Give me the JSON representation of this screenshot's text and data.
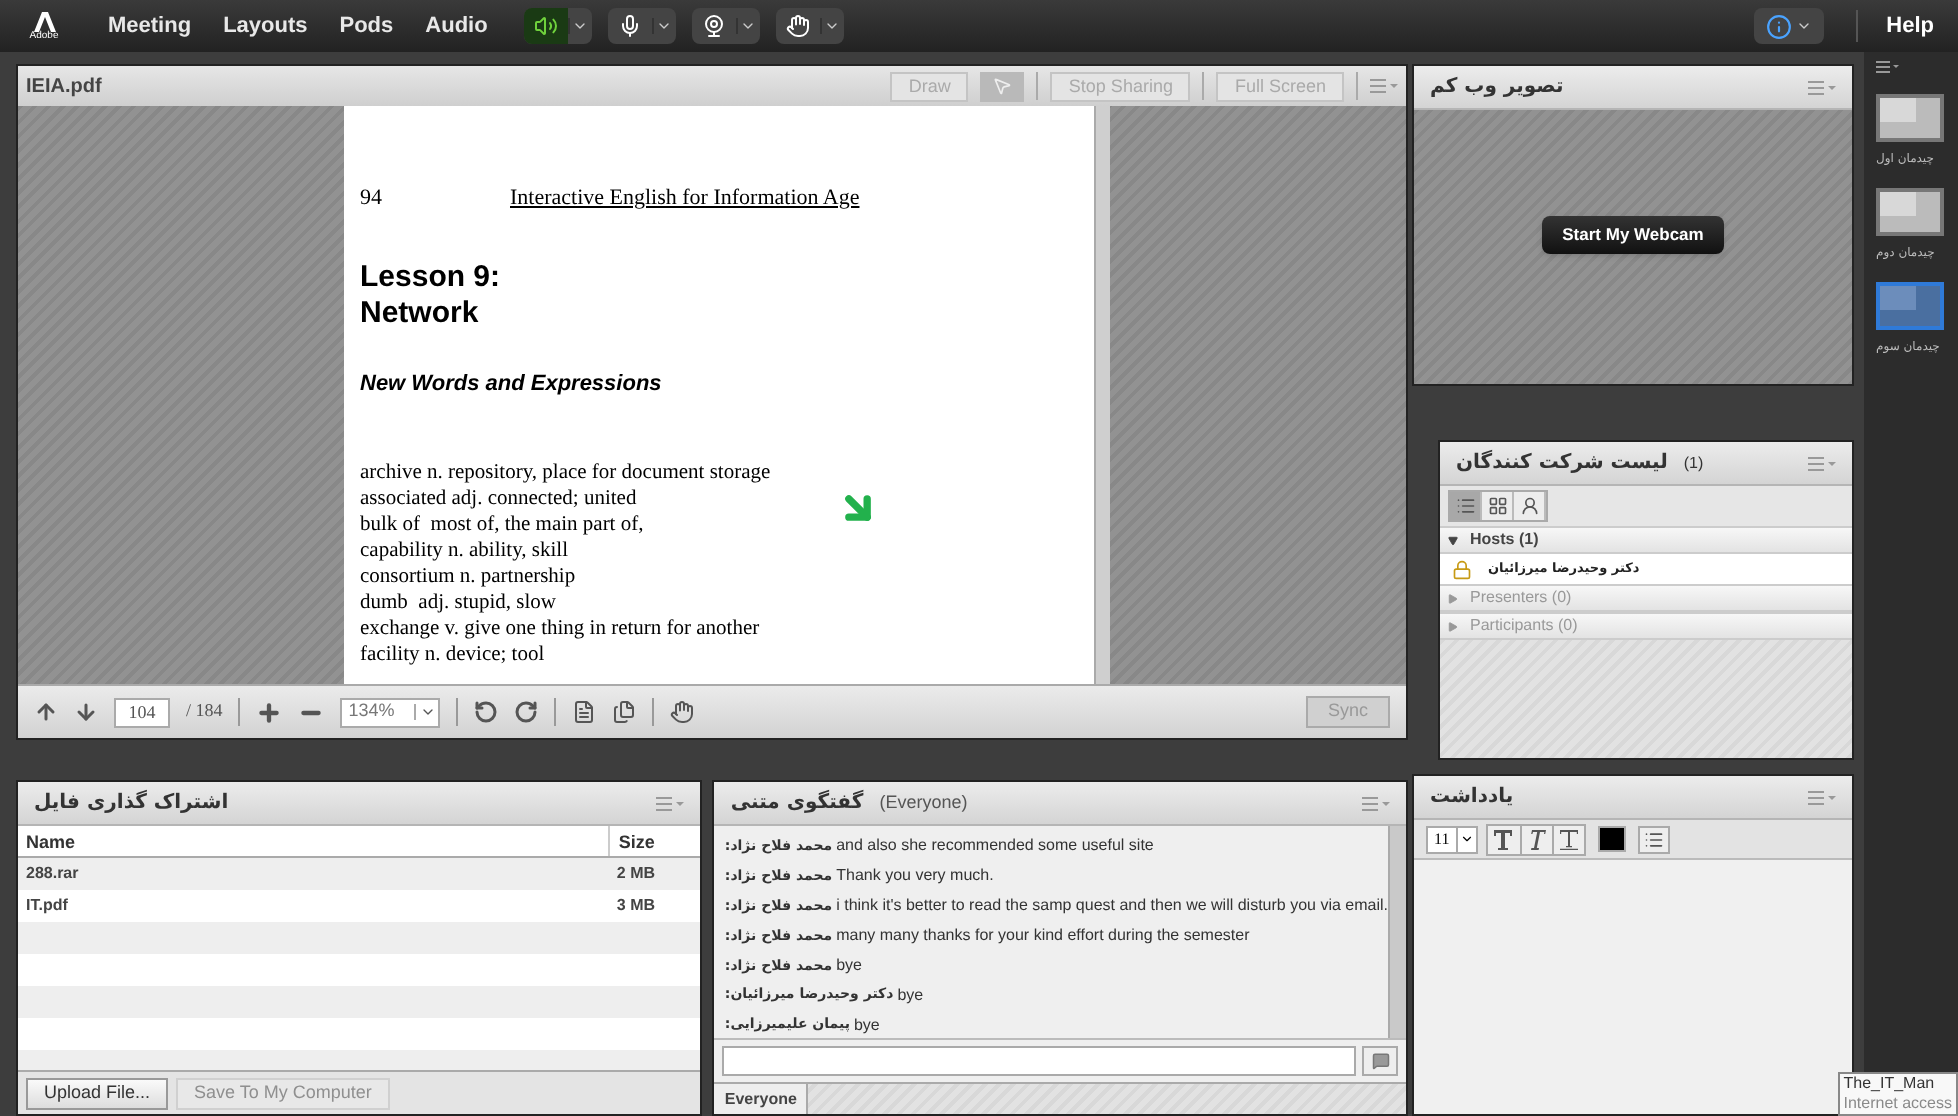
{
  "top_bar": {
    "logo": "Adobe",
    "menus": [
      "Meeting",
      "Layouts",
      "Pods",
      "Audio"
    ],
    "help": "Help"
  },
  "media_buttons": [
    {
      "kind": "speaker",
      "on": true
    },
    {
      "kind": "microphone",
      "on": false
    },
    {
      "kind": "webcam",
      "on": false
    },
    {
      "kind": "raise-hand",
      "on": false
    }
  ],
  "share_pod": {
    "title": "IEIA.pdf",
    "buttons": [
      "Draw",
      "Stop Sharing",
      "Full Screen"
    ],
    "document": {
      "page_number": "94",
      "header": "Interactive English for Information Age",
      "lesson": [
        "Lesson 9:",
        "Network"
      ],
      "section": "New Words and Expressions",
      "entries": [
        "archive n. repository, place for document storage",
        "associated adj. connected; united",
        "bulk of  most of, the main part of,",
        "capability n. ability, skill",
        "consortium n. partnership",
        "dumb  adj. stupid, slow",
        "exchange v. give one thing in return for another",
        "facility n. device; tool"
      ]
    },
    "toolbar": {
      "page": "104",
      "total": "/ 184",
      "zoom": "134%",
      "sync": "Sync"
    }
  },
  "webcam_pod": {
    "title": "تصویر وب کم",
    "button": "Start My Webcam"
  },
  "attendees_pod": {
    "title": "لیست شرکت کنندگان",
    "count": "(1)",
    "views": [
      {
        "kind": "list",
        "selected": true
      },
      {
        "kind": "grid",
        "selected": false
      },
      {
        "kind": "roles",
        "selected": false
      }
    ],
    "groups": [
      {
        "label": "Hosts (1)",
        "expanded": true,
        "children": [
          {
            "name": "دکتر وحیدرضا میرزائیان"
          }
        ]
      },
      {
        "label": "Presenters (0)",
        "expanded": false
      },
      {
        "label": "Participants (0)",
        "expanded": false
      }
    ]
  },
  "files_pod": {
    "title": "اشتراک گذاری فایل",
    "columns": [
      "Name",
      "Size"
    ],
    "rows": [
      [
        "288.rar",
        "2 MB"
      ],
      [
        "IT.pdf",
        "3 MB"
      ]
    ],
    "buttons": [
      {
        "label": "Upload File...",
        "disabled": false
      },
      {
        "label": "Save To My Computer",
        "disabled": true
      }
    ]
  },
  "chat_pod": {
    "title": "گفتگوی متنی",
    "audience": "(Everyone)",
    "messages": [
      {
        "sender": "محمد فلاح نژاد:",
        "text": "and also she recommended some useful site"
      },
      {
        "sender": "محمد فلاح نژاد:",
        "text": "Thank you very much."
      },
      {
        "sender": "محمد فلاح نژاد:",
        "text": "i think it's better to read the samp quest and then we will disturb you via email."
      },
      {
        "sender": "محمد فلاح نژاد:",
        "text": "many many thanks for your kind effort during the semester"
      },
      {
        "sender": "محمد فلاح نژاد:",
        "text": "bye"
      },
      {
        "sender": "دکتر وحیدرضا میرزائیان:",
        "text": "bye"
      },
      {
        "sender": "پیمان علیمیرزایی:",
        "text": "bye"
      }
    ],
    "tab": "Everyone"
  },
  "notes_pod": {
    "title": "یادداشت",
    "font_size": "11"
  },
  "layouts": [
    {
      "label": "چیدمان اول",
      "selected": false
    },
    {
      "label": "چیدمان دوم",
      "selected": false
    },
    {
      "label": "چیدمان سوم",
      "selected": true
    }
  ],
  "tooltip": [
    "The_IT_Man",
    "Internet access"
  ]
}
